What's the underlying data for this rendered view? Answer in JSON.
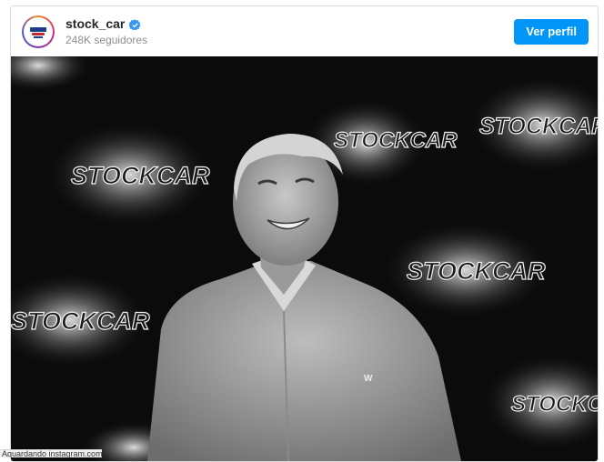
{
  "post": {
    "username": "stock_car",
    "followers": "248K seguidores",
    "view_profile_label": "Ver perfil",
    "avatar_text": "STOCK CAR"
  },
  "photo": {
    "backdrop_logo_text": "STOCKCAR",
    "shirt_logo_text": "W"
  },
  "status_bar": {
    "text": "Aguardando instagram.com..."
  },
  "colors": {
    "accent": "#0095f6",
    "username": "#262626",
    "secondary_text": "#8e8e8e",
    "verified": "#3897f0"
  }
}
